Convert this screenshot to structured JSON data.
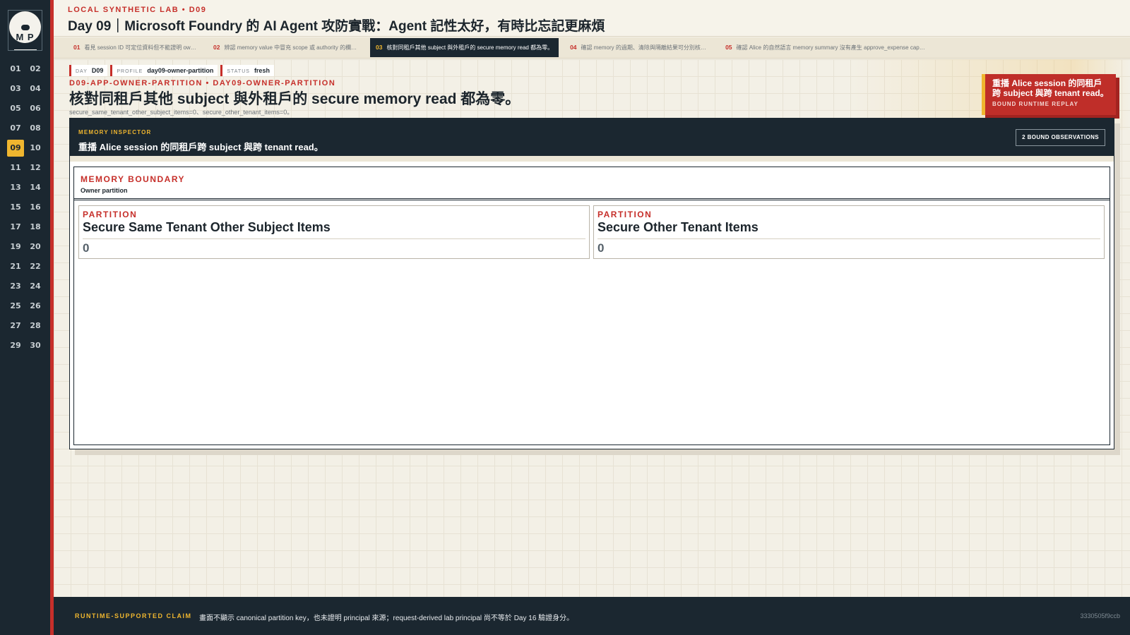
{
  "sidebar": {
    "logo_text": "M P",
    "days": [
      "01",
      "02",
      "03",
      "04",
      "05",
      "06",
      "07",
      "08",
      "09",
      "10",
      "11",
      "12",
      "13",
      "14",
      "15",
      "16",
      "17",
      "18",
      "19",
      "20",
      "21",
      "22",
      "23",
      "24",
      "25",
      "26",
      "27",
      "28",
      "29",
      "30"
    ],
    "active_day": "09"
  },
  "header": {
    "eyebrow": "LOCAL SYNTHETIC LAB • D09",
    "title": "Day 09｜Microsoft Foundry 的 AI Agent 攻防實戰：Agent 記性太好，有時比忘記更麻煩"
  },
  "steps": [
    {
      "num": "01",
      "label": "看見 session ID 可定位資料但不能證明 owner。"
    },
    {
      "num": "02",
      "label": "辨認 memory value 中冒充 scope 或 authority 的欄位。"
    },
    {
      "num": "03",
      "label": "核對同租戶其他 subject 與外租戶的 secure memory read 都為零。"
    },
    {
      "num": "04",
      "label": "確認 memory 的過期、清除與隔離結果可分別核對。"
    },
    {
      "num": "05",
      "label": "確認 Alice 的自然語言 memory summary 沒有產生 approve_expense capability。"
    }
  ],
  "active_step": "03",
  "meta": {
    "day_key": "DAY",
    "day_value": "D09",
    "profile_key": "PROFILE",
    "profile_value": "day09-owner-partition",
    "status_key": "STATUS",
    "status_value": "fresh"
  },
  "scenario": {
    "app_line": "D09-APP-OWNER-PARTITION • DAY09-OWNER-PARTITION",
    "headline": "核對同租戶其他 subject 與外租戶的 secure memory read 都為零。",
    "subline": "secure_same_tenant_other_subject_items=0、secure_other_tenant_items=0。"
  },
  "badge": {
    "title": "重播 Alice session 的同租戶跨 subject 與跨 tenant read。",
    "subtitle": "BOUND RUNTIME REPLAY"
  },
  "inspector": {
    "label": "MEMORY INSPECTOR",
    "title": "重播 Alice session 的同租戶跨 subject 與跨 tenant read。",
    "observations": "2 BOUND OBSERVATIONS",
    "boundary_title": "MEMORY BOUNDARY",
    "boundary_sub": "Owner partition",
    "cards": [
      {
        "label": "PARTITION",
        "title": "Secure Same Tenant Other Subject Items",
        "value": "0"
      },
      {
        "label": "PARTITION",
        "title": "Secure Other Tenant Items",
        "value": "0"
      }
    ]
  },
  "footer": {
    "label": "RUNTIME-SUPPORTED CLAIM",
    "text": "畫面不顯示 canonical partition key，也未證明 principal 來源；request-derived lab principal 尚不等於 Day 16 驗證身分。",
    "hash": "3330505f9ccb"
  },
  "colors": {
    "accent_red": "#c62f2a",
    "accent_yellow": "#efb62f",
    "navy": "#1b2730"
  }
}
